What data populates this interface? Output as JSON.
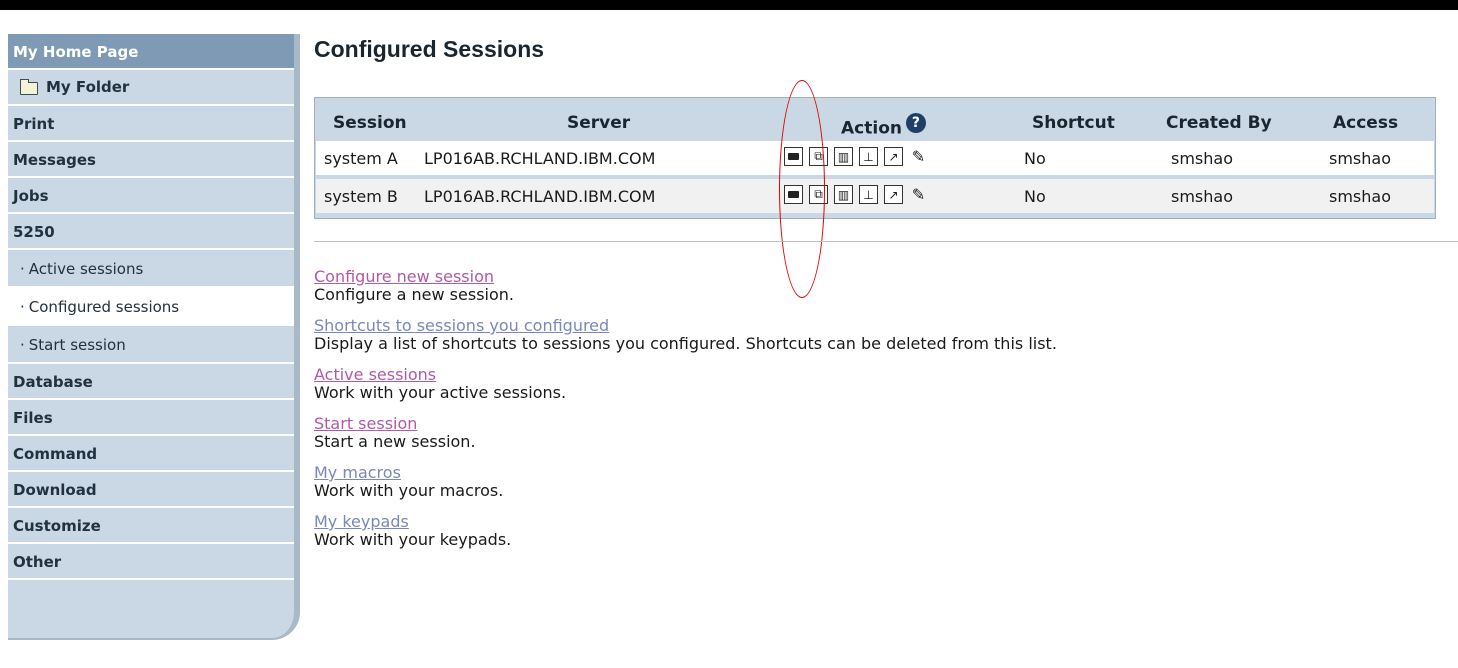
{
  "sidebar": {
    "home": "My Home Page",
    "folder": "My Folder",
    "items": [
      "Print",
      "Messages",
      "Jobs",
      "5250"
    ],
    "subitems": [
      "Active sessions",
      "Configured sessions",
      "Start session"
    ],
    "items_after": [
      "Database",
      "Files",
      "Command",
      "Download",
      "Customize",
      "Other"
    ]
  },
  "main": {
    "title": "Configured Sessions",
    "table": {
      "columns": [
        "Session",
        "Server",
        "Action",
        "Shortcut",
        "Created By",
        "Access"
      ],
      "rows": [
        {
          "session": "system A",
          "server": "LP016AB.RCHLAND.IBM.COM",
          "shortcut": "No",
          "created_by": "smshao",
          "access": "smshao"
        },
        {
          "session": "system B",
          "server": "LP016AB.RCHLAND.IBM.COM",
          "shortcut": "No",
          "created_by": "smshao",
          "access": "smshao"
        }
      ],
      "action_icons": [
        "start-session-icon",
        "copy-icon",
        "delete-icon",
        "print-icon",
        "shortcut-icon",
        "edit-icon"
      ]
    },
    "links": [
      {
        "text": "Configure new session",
        "desc": "Configure a new session.",
        "visited": true
      },
      {
        "text": "Shortcuts to sessions you configured",
        "desc": "Display a list of shortcuts to sessions you configured. Shortcuts can be deleted from this list.",
        "visited": false
      },
      {
        "text": "Active sessions",
        "desc": "Work with your active sessions.",
        "visited": true
      },
      {
        "text": "Start session",
        "desc": "Start a new session.",
        "visited": true
      },
      {
        "text": "My macros",
        "desc": "Work with your macros.",
        "visited": false
      },
      {
        "text": "My keypads",
        "desc": "Work with your keypads.",
        "visited": false
      }
    ]
  },
  "colors": {
    "sidebar_bg": "#c9d8e4",
    "home_bg": "#7f9ab4",
    "link": "#7a88b8",
    "visited_link": "#b05aa6",
    "annotation": "#e00000"
  }
}
